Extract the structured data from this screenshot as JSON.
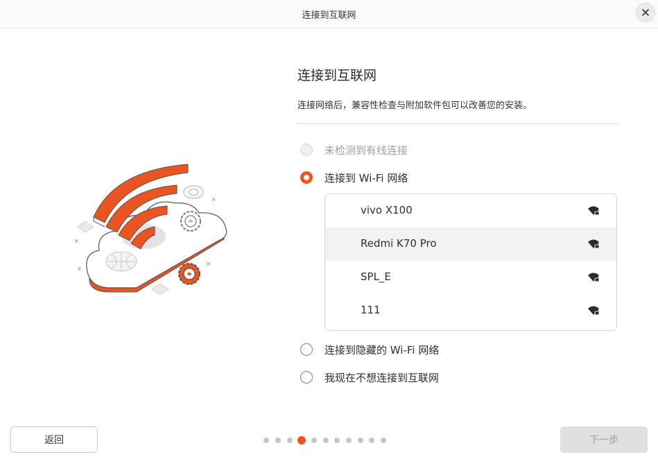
{
  "window": {
    "title": "连接到互联网"
  },
  "main": {
    "heading": "连接到互联网",
    "subtitle": "连接网络后，兼容性检查与附加软件包可以改善您的安装。",
    "options": [
      {
        "label": "未检测到有线连接",
        "state": "disabled"
      },
      {
        "label": "连接到 Wi-Fi 网络",
        "state": "checked"
      },
      {
        "label": "连接到隐藏的 Wi-Fi 网络",
        "state": "unchecked"
      },
      {
        "label": "我现在不想连接到互联网",
        "state": "unchecked"
      }
    ],
    "networks": [
      {
        "name": "vivo X100",
        "icon": "wifi-secure-icon",
        "selected": false
      },
      {
        "name": "Redmi K70 Pro",
        "icon": "wifi-secure-icon",
        "selected": true
      },
      {
        "name": "SPL_E",
        "icon": "wifi-secure-icon",
        "selected": false
      },
      {
        "name": "111",
        "icon": "wifi-secure-icon",
        "selected": false
      }
    ]
  },
  "footer": {
    "back_label": "返回",
    "next_label": "下一步",
    "pager": {
      "total": 11,
      "current": 3
    }
  },
  "colors": {
    "accent": "#e95420",
    "disabled_text": "#a0a0a0",
    "selected_row": "#f2f2f2"
  }
}
